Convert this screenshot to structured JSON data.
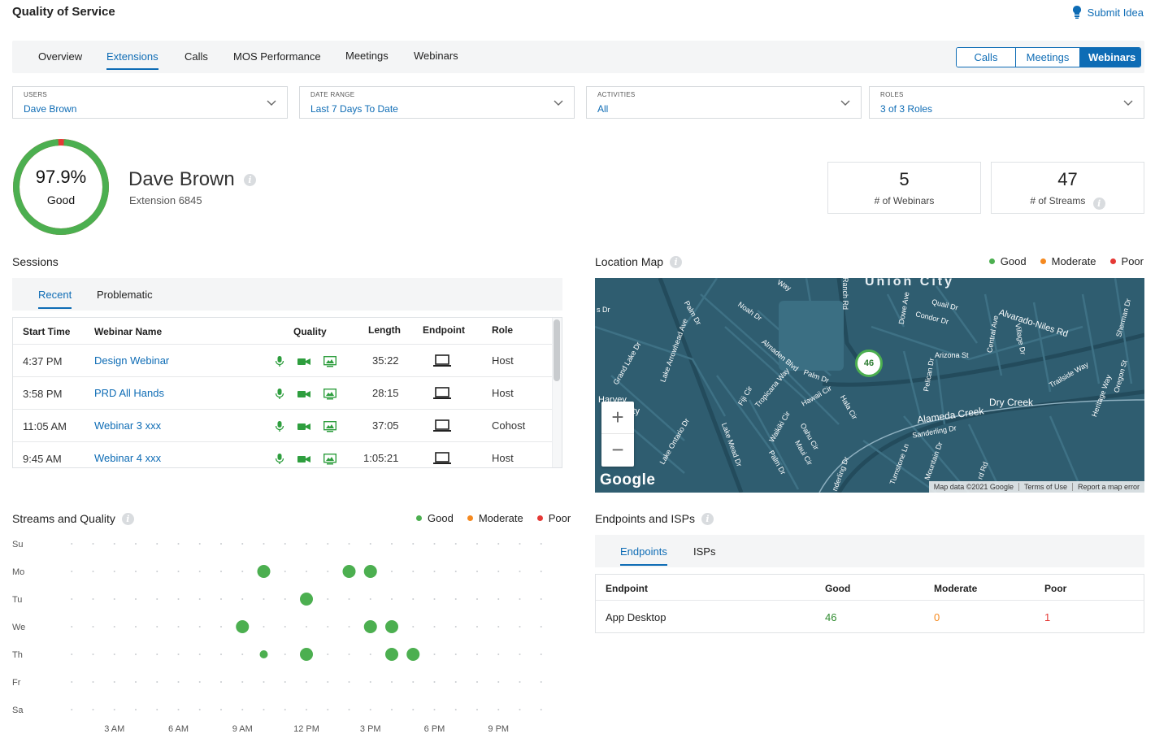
{
  "header": {
    "title": "Quality of Service",
    "submit_idea": "Submit Idea"
  },
  "tabs": [
    "Overview",
    "Extensions",
    "Calls",
    "MOS Performance",
    "Meetings",
    "Webinars"
  ],
  "active_tab": "Extensions",
  "segments": [
    "Calls",
    "Meetings",
    "Webinars"
  ],
  "active_segment": "Webinars",
  "filters": [
    {
      "label": "USERS",
      "value": "Dave Brown"
    },
    {
      "label": "DATE RANGE",
      "value": "Last 7 Days To Date"
    },
    {
      "label": "ACTIVITIES",
      "value": "All"
    },
    {
      "label": "ROLES",
      "value": "3 of 3 Roles"
    }
  ],
  "score": {
    "value": "97.9%",
    "label": "Good",
    "fraction": 0.979
  },
  "user": {
    "name": "Dave Brown",
    "extension": "Extension 6845"
  },
  "stats": [
    {
      "value": "5",
      "label": "# of Webinars"
    },
    {
      "value": "47",
      "label": "# of Streams"
    }
  ],
  "sessions": {
    "title": "Sessions",
    "tabs": [
      "Recent",
      "Problematic"
    ],
    "columns": [
      "Start Time",
      "Webinar Name",
      "Quality",
      "Length",
      "Endpoint",
      "Role"
    ],
    "rows": [
      {
        "start": "4:37 PM",
        "name": "Design Webinar",
        "length": "35:22",
        "role": "Host"
      },
      {
        "start": "3:58 PM",
        "name": "PRD All Hands",
        "length": "28:15",
        "role": "Host"
      },
      {
        "start": "11:05 AM",
        "name": "Webinar 3 xxx",
        "length": "37:05",
        "role": "Cohost"
      },
      {
        "start": "9:45 AM",
        "name": "Webinar 4 xxx",
        "length": "1:05:21",
        "role": "Host"
      }
    ]
  },
  "location_map": {
    "title": "Location Map",
    "legend": [
      "Good",
      "Moderate",
      "Poor"
    ],
    "marker_count": "46",
    "labels": {
      "city": "Union City",
      "creek1": "Alameda Creek",
      "creek2": "Dry Creek",
      "alvarado": "Alvarado-Niles Rd",
      "harvey": "Harvey",
      "ity": "ity",
      "arizona": "Arizona St",
      "condor": "Condor Dr",
      "quail": "Quail Dr",
      "noah": "Noah Dr",
      "palm": "Palm Dr",
      "hawaii": "Hawaii Cir",
      "tropicana": "Tropicana Way",
      "almaden": "Almaden Blvd",
      "fiji": "Fiji Cir",
      "sanderling": "Sanderling Dr",
      "trailside": "Trailside Way",
      "heritage": "Heritage Way",
      "lake_ontario": "Lake Ontario Dr",
      "lake_mead": "Lake Mead Dr",
      "grand_lake": "Grand Lake Dr",
      "lake_arrowhead": "Lake Arrowhead Ave",
      "central": "Central Ave",
      "pelican": "Pelican Dr",
      "dowe": "Dowe Ave",
      "ranch": "Ranch Rd",
      "village": "Village Dr",
      "oregon": "Oregon St",
      "sherman": "Sherman Dr",
      "turnstone": "Turnstone Ln",
      "mountain": "Mountain Dr",
      "hala": "Hala Cir",
      "oahu": "Oahu Cir",
      "maui": "Maui Cir",
      "waikiki": "Waikiki Cir",
      "palm2": "Palm Dr",
      "palm3": "Palm Dr",
      "way": "Way",
      "sdr": "s Dr",
      "derling": "nderling Dr",
      "rd": "rd Rd"
    },
    "google": "Google",
    "attribution": [
      "Map data ©2021 Google",
      "Terms of Use",
      "Report a map error"
    ],
    "zoom_in": "+",
    "zoom_out": "−"
  },
  "streams_quality": {
    "title": "Streams and Quality",
    "legend": [
      "Good",
      "Moderate",
      "Poor"
    ]
  },
  "chart_data": {
    "type": "scatter",
    "title": "Streams and Quality",
    "y_categories": [
      "Su",
      "Mo",
      "Tu",
      "We",
      "Th",
      "Fr",
      "Sa"
    ],
    "x_ticks": [
      {
        "hour": 3,
        "label": "3 AM"
      },
      {
        "hour": 6,
        "label": "6 AM"
      },
      {
        "hour": 9,
        "label": "9 AM"
      },
      {
        "hour": 12,
        "label": "12 PM"
      },
      {
        "hour": 15,
        "label": "3 PM"
      },
      {
        "hour": 18,
        "label": "6 PM"
      },
      {
        "hour": 21,
        "label": "9 PM"
      }
    ],
    "x_range": [
      0,
      24
    ],
    "series": [
      {
        "name": "Good",
        "color": "#4caf50",
        "points": [
          {
            "day": "Mo",
            "hour": 10,
            "size": "large"
          },
          {
            "day": "Mo",
            "hour": 14,
            "size": "large"
          },
          {
            "day": "Mo",
            "hour": 15,
            "size": "large"
          },
          {
            "day": "Tu",
            "hour": 12,
            "size": "large"
          },
          {
            "day": "We",
            "hour": 9,
            "size": "large"
          },
          {
            "day": "We",
            "hour": 15,
            "size": "large"
          },
          {
            "day": "We",
            "hour": 16,
            "size": "large"
          },
          {
            "day": "Th",
            "hour": 10,
            "size": "small"
          },
          {
            "day": "Th",
            "hour": 12,
            "size": "large"
          },
          {
            "day": "Th",
            "hour": 16,
            "size": "large"
          },
          {
            "day": "Th",
            "hour": 17,
            "size": "large"
          }
        ]
      }
    ],
    "legend": [
      "Good",
      "Moderate",
      "Poor"
    ],
    "legend_colors": [
      "#4caf50",
      "#f5891f",
      "#e53935"
    ]
  },
  "endpoints": {
    "title": "Endpoints and ISPs",
    "tabs": [
      "Endpoints",
      "ISPs"
    ],
    "columns": [
      "Endpoint",
      "Good",
      "Moderate",
      "Poor"
    ],
    "rows": [
      {
        "endpoint": "App Desktop",
        "good": "46",
        "moderate": "0",
        "poor": "1"
      }
    ]
  },
  "colors": {
    "accent": "#0e6cb5",
    "good": "#4caf50",
    "moderate": "#f5891f",
    "poor": "#e53935"
  }
}
